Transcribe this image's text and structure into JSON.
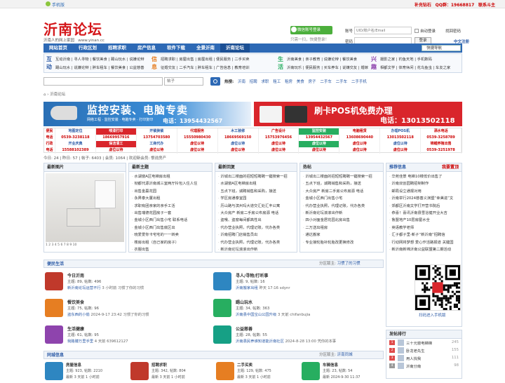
{
  "topbar": {
    "mobile": "手机版",
    "right": [
      {
        "t": "补充钻石",
        "c": "red"
      },
      {
        "t": "QQ群：19668817",
        "c": "red"
      },
      {
        "t": "联系斗主",
        "c": "red"
      }
    ]
  },
  "header": {
    "logo": "沂南论坛",
    "slogan": "沂南人的网上家园",
    "domain": "www.yinan.cc",
    "wx_login": "微信账号登录",
    "wx_sub": "只需一扫，快捷登录！",
    "login": {
      "user_label": "账号",
      "user_placeholder": "UID/账户名/Email",
      "pass_label": "密码",
      "remember": "自动登录",
      "find_pwd": "找回密码",
      "login_btn": "登录",
      "register": "中文注册"
    }
  },
  "nav": {
    "items": [
      "网站首页",
      "行政区划",
      "招聘求职",
      "房产信息",
      "软件下载",
      "全景沂南",
      "沂南论坛"
    ],
    "active": "沂南论坛",
    "quick": "快捷导航"
  },
  "categories": [
    {
      "label": "互动",
      "links": [
        "互动沂南 | 寻人寻物 | 餐饮美食 | 踢山玩水 | 说嫌论辩",
        "踢山玩水 | 说嫌论辩 | 胖车租车 | 餐饮美食 | 公益慈善"
      ]
    },
    {
      "label": "信息",
      "links": [
        "招聘求职 | 房屋出售 | 房屋出租 | 便民服务 | 二手买卖",
        "征婚交友 | 二手汽车 | 胖车租车 | 广告信息 | 教育培训"
      ]
    },
    {
      "label": "生活",
      "links": [
        "沂南美食 | 亲子教育 | 说嫌论辩 | 餐饮美食",
        "沂南玩乐 | 便民服务 | 买车养车 | 说嫌交友 | 婚嫁"
      ]
    },
    {
      "label": "兴趣",
      "links": [
        "摄影之家 | 钓鱼天地 | 手机数码",
        "相都文学 | 体育休闲 | 花鸟鱼虫 | 车友之家"
      ]
    }
  ],
  "search": {
    "scope": "帖子",
    "hot_label": "热搜:",
    "hot": [
      "沂南",
      "招聘",
      "求职",
      "租工",
      "租房",
      "美食",
      "房子",
      "二手车",
      "二手车",
      "二手手机"
    ]
  },
  "crumb": "沂南论坛",
  "banners": {
    "b1_title": "监控安装、电脑专卖",
    "b1_sub": "网络工程 · 监控安装 · 电脑专卖 · 打印复印",
    "b1_phone": "电话：13954432567",
    "b2_title": "刷卡POS机免费办理",
    "b2_phone": "电话：13013502118"
  },
  "adgrid": [
    [
      "便民",
      "地图定位",
      "喷漆打印",
      "开锁换锁",
      "代理服务",
      "木工装修",
      "广告设计",
      "监控安装",
      "电脑租赁",
      "办理POS机",
      "洒水电话"
    ],
    [
      "电话",
      "0539-3238118",
      "18669957916",
      "13754703580",
      "15550980430",
      "18669569150",
      "15753976456",
      "13954432567",
      "13608690440",
      "13013502118",
      "0539-3258789"
    ],
    [
      "行政",
      "开业庆典",
      "保洁清工",
      "工商代办",
      "虚位以待",
      "虚位以待",
      "虚位以待",
      "虚位以待",
      "虚位以待",
      "虚位以待",
      "锦鲤养殖出售"
    ],
    [
      "电话",
      "15588102389",
      "虚位以待",
      "虚位以待",
      "虚位以待",
      "虚位以待",
      "虚位以待",
      "虚位以待",
      "虚位以待",
      "虚位以待",
      "0539-3251978"
    ]
  ],
  "stats": {
    "today": "今日: 24",
    "yesterday": "昨日: 57",
    "posts": "帖子: 6403",
    "members": "会员: 1064",
    "welcome": "欢迎新会员: 恨说房产"
  },
  "latest_images": {
    "title": "最新图片",
    "dots": "1 2 3 4 5 6 7 8 9 10"
  },
  "new_topics": {
    "title": "最新主题",
    "items": [
      "水湖窗A区电梯房出租",
      "彻都代源沂南城三室两厅拎包入住人住",
      "出售金赢花园",
      "永昇泰大厦出租",
      "求职有团亲家的亲手工活",
      "出售瑞德花园房子一套",
      "金城小区西门出售小宅 联系电话",
      "金城小区西门出售底区出",
      "晓爱爱你卡宅宅的一一转卖",
      "楼房出租（自己家的房子）",
      "衣服出售"
    ]
  },
  "new_replies": {
    "title": "最新回复",
    "items": [
      "沂城出二楼面的招短短聘聘一键搜索一招",
      "水湖窗A区电梯房出租",
      "五点下班，诚聘销售和采购，接送",
      "学区房通泰宜园",
      "历山路与滨州玛大道交汇处汇丰公寓",
      "大众房产 新房二手房公布房源 电话",
      "盗哦、盗窗每间都高性出",
      "代办营业执照，代理记账，代办各类",
      "沂南招聘门店销售员出",
      "代办营业执照，代理记账，代办各类",
      "新沂南论坛滚滚出作新"
    ]
  },
  "hot": {
    "title": "热帖",
    "items": [
      "沂城出二楼面的招短短聘聘一键搜索一招",
      "五点下班，诚聘销售和采购，接送",
      "大众房产 新房二手房公布房源 电话",
      "金城小区西门出售小宅",
      "代办营业执照，代理记账，代办各类",
      "新沂南论坛滚滚出作新",
      "四小对面金居花园北房出售",
      "二万送出租房",
      "通达搬家",
      "专业接轮胎补轮胎改更换修改"
    ]
  },
  "rec": {
    "title": "推荐信息",
    "more": "我要置顶",
    "items": [
      "华苑佳景 电梯10楼低价出售了",
      "沂南双创园聘招制制作",
      "邮局设立通报对用",
      "沂南举行2024慈善义演暨“幸美进”文",
      "郊都区沂南文学打开营书院后",
      "恭喜！喜讯沂南县雪浴健开业大吉",
      "鲁盟地产10层房屋水全",
      "英语教学老师",
      "汇子都子里-新子“新沂南”招聘信",
      "行动网将梦想 爱心作活路报道 关键国",
      "新沂南新锦沂南公益联盟第二期活动"
    ]
  },
  "qr": {
    "text": "扫码进入手机版"
  },
  "sec1": {
    "title": "便民生活",
    "mods_label": "分区版主:",
    "mods": "习惯了的习惯"
  },
  "forums1": [
    {
      "name": "今日沂南",
      "stat": "主题: 89, 帖数: 496",
      "last": "新沂南论坛运营不行",
      "time": "3 小时前 习惯了你的习惯",
      "color": "#c0392b"
    },
    {
      "name": "寻人/寻物/打听事",
      "stat": "主题: 9, 帖数: 16",
      "last": "沂南搬家出租",
      "time": "昨天 17:16 sdynr",
      "color": "#2e86c1"
    },
    {
      "name": "餐饮美食",
      "stat": "主题: 75, 帖数: 96",
      "last": "盗东西的小偷",
      "time": "2024-9-17 23:42 习惯了你的习惯",
      "color": "#e67e22"
    },
    {
      "name": "踢山玩水",
      "stat": "主题: 34, 帖数: 363",
      "last": "沂南县中国宝山公园升级",
      "time": "3 天前 chifanbujia",
      "color": "#27ae60"
    },
    {
      "name": "生活健康",
      "stat": "主题: 61, 帖数: 95",
      "last": "我胳膊万里手里",
      "time": "4 天前 639612127",
      "color": "#8e44ad"
    },
    {
      "name": "公益慈善",
      "stat": "主题: 28, 帖数: 55",
      "last": "沂南县民养谁知道能沂南社区",
      "time": "2024-8-28 13:00 凭你的本事",
      "color": "#16a085"
    }
  ],
  "sec2": {
    "title": "同城信息",
    "mods_label": "分区版主:",
    "mods": "沂南同城"
  },
  "forums2": [
    {
      "name": "房屋信息",
      "stat": "主题: 923, 帖数: 2210",
      "last": "最新 3 天前 1 小时前",
      "color": "#2e86c1"
    },
    {
      "name": "招聘求职",
      "stat": "主题: 342, 帖数: 804",
      "last": "最新 3 天前 1 小时前",
      "color": "#c0392b"
    },
    {
      "name": "二手买卖",
      "stat": "主题: 129, 帖数: 475",
      "last": "最新 3 天前 1 小时前",
      "color": "#e67e22"
    },
    {
      "name": "车辆信息",
      "stat": "主题: 23, 帖数: 54",
      "last": "最新 2024-9-30 11:37",
      "color": "#27ae60"
    }
  ],
  "rank": {
    "title": "发帖排行",
    "items": [
      {
        "n": "三十元窗电梯梯",
        "c": "245"
      },
      {
        "n": "卧龙老先生",
        "c": "155"
      },
      {
        "n": "用人找我",
        "c": "111"
      },
      {
        "n": "沂南分南",
        "c": "98"
      }
    ]
  }
}
